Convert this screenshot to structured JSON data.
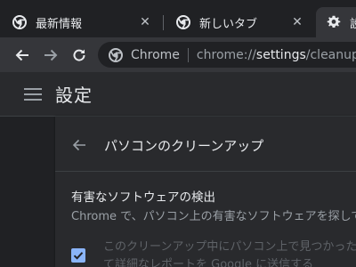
{
  "colors": {
    "frame": "#202124",
    "toolbar": "#35363a",
    "omnibox": "#202124",
    "settings_header": "#292a2d",
    "card": "#292a2d",
    "accent": "#8ab4f8",
    "text_primary": "#e8eaed",
    "text_secondary": "#9aa0a6"
  },
  "tabs": [
    {
      "title": "最新情報",
      "icon": "chrome-icon",
      "active": false,
      "close": "✕"
    },
    {
      "title": "新しいタブ",
      "icon": "chrome-icon",
      "active": false,
      "close": "✕"
    },
    {
      "title": "設定",
      "icon": "gear-icon",
      "active": true
    }
  ],
  "toolbar": {
    "back_icon": "back-arrow-icon",
    "forward_icon": "forward-arrow-icon",
    "reload_icon": "reload-icon",
    "omnibox": {
      "chip": "Chrome",
      "url_scheme": "chrome://",
      "url_host": "settings",
      "url_path": "/cleanup"
    }
  },
  "settings_header": {
    "title": "設定",
    "menu_icon": "hamburger-menu-icon"
  },
  "subpage": {
    "title": "パソコンのクリーンアップ",
    "back_icon": "back-arrow-icon",
    "section_heading": "有害なソフトウェアの検出",
    "section_description": "Chrome で、パソコン上の有害なソフトウェアを探して",
    "checkbox": {
      "checked": true,
      "label_line1": "このクリーンアップ中にパソコン上で見つかった",
      "label_line2": "て詳細なレポートを Google に送信する"
    }
  }
}
